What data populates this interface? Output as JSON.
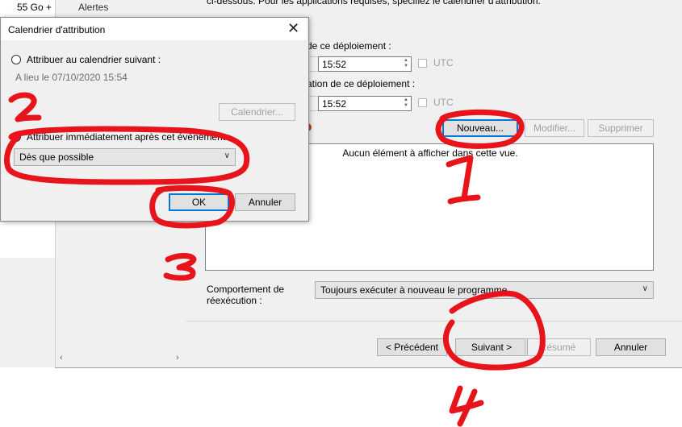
{
  "background_window": {
    "left_pane": {
      "size_text": "55 Go +",
      "nav_item": "Alertes"
    },
    "description_text": "ci-dessous. Pour les applications requises, spécifiez le calendrier d'attribution.",
    "available_time_label": "de ce déploiement :",
    "available_time_value": "15:52",
    "deadline_label": "ation de ce déploiement :",
    "deadline_time_value": "15:52",
    "utc_label": "UTC",
    "buttons": {
      "new": "Nouveau...",
      "modify": "Modifier...",
      "delete": "Supprimer"
    },
    "list_empty_text": "Aucun élément à afficher dans cette vue.",
    "rerun_label": "Comportement de réexécution :",
    "rerun_value": "Toujours exécuter à nouveau le programme",
    "wizard_buttons": {
      "previous": "< Précédent",
      "next": "Suivant >",
      "summary": "Résumé",
      "cancel": "Annuler"
    }
  },
  "dialog": {
    "title": "Calendrier d'attribution",
    "option_schedule": "Attribuer au calendrier suivant :",
    "schedule_info": "A lieu le 07/10/2020 15:54",
    "calendar_button": "Calendrier...",
    "option_event": "Attribuer immédiatement après cet événement :",
    "event_value": "Dès que possible",
    "ok": "OK",
    "cancel": "Annuler"
  },
  "annotations": {
    "color": "#e8141b",
    "steps": [
      "1",
      "2",
      "3",
      "4"
    ]
  }
}
